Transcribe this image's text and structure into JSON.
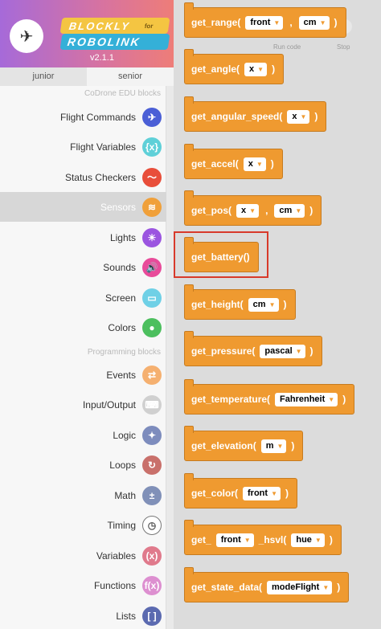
{
  "header": {
    "logo_line1": "BLOCKLY",
    "logo_for": "for",
    "logo_line2": "ROBOLINK",
    "version": "v2.1.1"
  },
  "levels": [
    "junior",
    "senior"
  ],
  "toolbox": {
    "section_edu": "CoDrone EDU blocks",
    "section_programming": "Programming blocks",
    "categories": [
      {
        "label": "Flight Commands",
        "color": "#4b5fd6",
        "icon": "drone-icon"
      },
      {
        "label": "Flight Variables",
        "color": "#5fd0d8",
        "icon": "variable-icon"
      },
      {
        "label": "Status Checkers",
        "color": "#e84e3a",
        "icon": "pulse-icon"
      },
      {
        "label": "Sensors",
        "color": "#f0a03a",
        "icon": "sensor-icon"
      },
      {
        "label": "Lights",
        "color": "#9b55e0",
        "icon": "bulb-icon"
      },
      {
        "label": "Sounds",
        "color": "#e84b9a",
        "icon": "speaker-icon"
      },
      {
        "label": "Screen",
        "color": "#6fd0e6",
        "icon": "screen-icon"
      },
      {
        "label": "Colors",
        "color": "#4cbf5e",
        "icon": "colors-icon"
      },
      {
        "label": "Events",
        "color": "#f5b070",
        "icon": "share-icon"
      },
      {
        "label": "Input/Output",
        "color": "#d0d0d0",
        "icon": "keyboard-icon"
      },
      {
        "label": "Logic",
        "color": "#7d8cbd",
        "icon": "logic-icon"
      },
      {
        "label": "Loops",
        "color": "#c9706b",
        "icon": "loop-icon"
      },
      {
        "label": "Math",
        "color": "#8090b8",
        "icon": "math-icon"
      },
      {
        "label": "Timing",
        "color": "#ffffff",
        "icon": "clock-icon"
      },
      {
        "label": "Variables",
        "color": "#e07a8c",
        "icon": "x-variable-icon"
      },
      {
        "label": "Functions",
        "color": "#dd8fd0",
        "icon": "function-icon"
      },
      {
        "label": "Lists",
        "color": "#5b6ab0",
        "icon": "list-icon"
      }
    ],
    "icon_glyphs": [
      "✈",
      "{x}",
      "〜",
      "≋",
      "☀",
      "🔊",
      "▭",
      "●",
      "⇄",
      "⌨",
      "✦",
      "↻",
      "±",
      "◷",
      "(x)",
      "f(x)",
      "[ ]"
    ]
  },
  "ghost": {
    "run_label": "Run code",
    "stop_label": "Stop"
  },
  "blocks": [
    {
      "text": "get_range(",
      "params": [
        "front",
        "cm"
      ],
      "close": ")"
    },
    {
      "text": "get_angle(",
      "params": [
        "x"
      ],
      "close": ")"
    },
    {
      "text": "get_angular_speed(",
      "params": [
        "x"
      ],
      "close": ")"
    },
    {
      "text": "get_accel(",
      "params": [
        "x"
      ],
      "close": ")"
    },
    {
      "text": "get_pos(",
      "params": [
        "x",
        "cm"
      ],
      "close": ")"
    },
    {
      "text": "get_battery()"
    },
    {
      "text": "get_height(",
      "params": [
        "cm"
      ],
      "close": ")"
    },
    {
      "text": "get_pressure(",
      "params": [
        "pascal"
      ],
      "close": ")"
    },
    {
      "text": "get_temperature(",
      "params": [
        "Fahrenheit"
      ],
      "close": ")"
    },
    {
      "text": "get_elevation(",
      "params": [
        "m"
      ],
      "close": ")"
    },
    {
      "text": "get_color(",
      "params": [
        "front"
      ],
      "close": ")"
    },
    {
      "text": "get_",
      "params": [
        "front"
      ],
      "mid": "_hsvl(",
      "params2": [
        "hue"
      ],
      "close": ")"
    },
    {
      "text": "get_state_data(",
      "params": [
        "modeFlight"
      ],
      "close": ")"
    }
  ]
}
